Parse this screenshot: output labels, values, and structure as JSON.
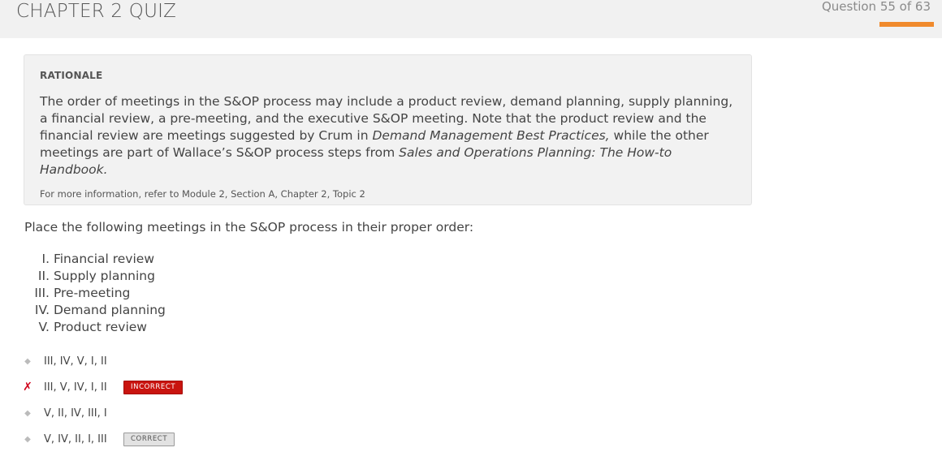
{
  "header": {
    "title": "CHAPTER 2 QUIZ",
    "question_counter": "Question 55 of 63",
    "progress_fraction": 0.873
  },
  "rationale": {
    "heading": "RATIONALE",
    "text_1": "The order of meetings in the S&OP process may include a product review, demand planning, supply planning, a financial review, a pre-meeting, and the executive S&OP meeting. Note that the product review and the financial review are meetings suggested by Crum in ",
    "text_italic_1": "Demand Management Best Practices,",
    "text_2": " while the other meetings are part of Wallace’s S&OP process steps from ",
    "text_italic_2": "Sales and Operations Planning: The How-to Handbook.",
    "reference": "For more information, refer to Module 2, Section A, Chapter 2, Topic 2"
  },
  "question": {
    "prompt": "Place the following meetings in the S&OP process in their proper order:",
    "items": [
      {
        "num": "I.",
        "text": "Financial review"
      },
      {
        "num": "II.",
        "text": "Supply planning"
      },
      {
        "num": "III.",
        "text": "Pre-meeting"
      },
      {
        "num": "IV.",
        "text": "Demand planning"
      },
      {
        "num": "V.",
        "text": "Product review"
      }
    ]
  },
  "answers": [
    {
      "marker": "◆",
      "text": "III, IV, V, I, II",
      "badge": ""
    },
    {
      "marker": "✗",
      "text": "III, V, IV, I, II",
      "badge": "INCORRECT"
    },
    {
      "marker": "◆",
      "text": "V, II, IV, III, I",
      "badge": ""
    },
    {
      "marker": "◆",
      "text": "V, IV, II, I, III",
      "badge": "CORRECT"
    }
  ],
  "colors": {
    "accent_progress": "#f08a2c",
    "incorrect_red": "#c9140f",
    "header_bg": "#f1f1f1"
  }
}
